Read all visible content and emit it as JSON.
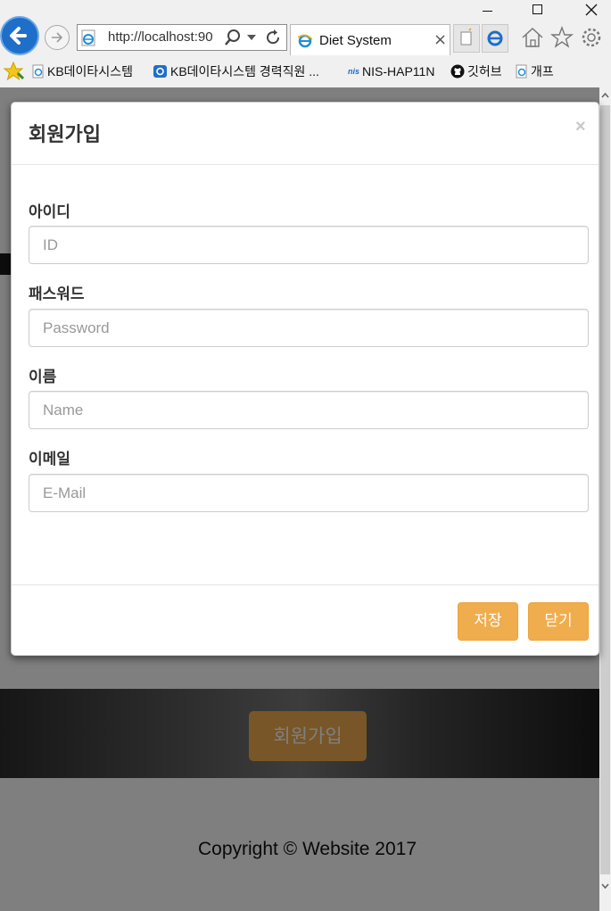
{
  "browser": {
    "address_url": "http://localhost:90",
    "tab_title": "Diet System",
    "favorites": [
      {
        "label": "KB데이타시스템",
        "icon": "ie-page-icon"
      },
      {
        "label": "KB데이타시스템 경력직원 ...",
        "icon": "kb-icon"
      },
      {
        "label": "NIS-HAP11N",
        "icon": "nis-logo",
        "logo_text": "nis"
      },
      {
        "label": "깃허브",
        "icon": "github-icon"
      },
      {
        "label": "개프",
        "icon": "ie-page-icon"
      }
    ]
  },
  "page": {
    "hero_signup_label": "회원가입",
    "footer_text": "Copyright © Website 2017"
  },
  "modal": {
    "title": "회원가입",
    "close_glyph": "×",
    "fields": {
      "id": {
        "label": "아이디",
        "placeholder": "ID",
        "value": ""
      },
      "password": {
        "label": "패스워드",
        "placeholder": "Password",
        "value": ""
      },
      "name": {
        "label": "이름",
        "placeholder": "Name",
        "value": ""
      },
      "email": {
        "label": "이메일",
        "placeholder": "E-Mail",
        "value": ""
      }
    },
    "save_label": "저장",
    "close_label": "닫기"
  },
  "colors": {
    "accent": "#f0ad4e",
    "browser_blue": "#1e6fc9"
  }
}
